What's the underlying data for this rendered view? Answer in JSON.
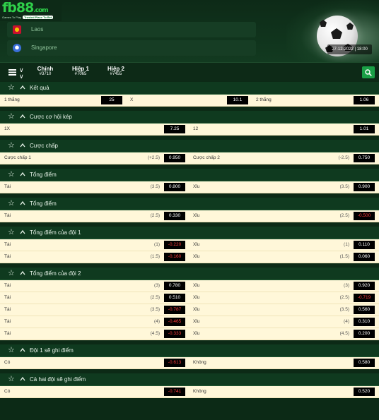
{
  "logo": {
    "brand": "fb88",
    "brand_suffix": ".com",
    "tagline": "Games To Play",
    "tagline_badge": "Trusted Place To Bet"
  },
  "teams": {
    "home": "Laos",
    "away": "Singapore"
  },
  "match_datetime": "27-12-2022 | 18:00",
  "tabs": [
    {
      "label": "Chính",
      "code": "#3710"
    },
    {
      "label": "Hiệp 1",
      "code": "#7065"
    },
    {
      "label": "Hiệp 2",
      "code": "#7455"
    }
  ],
  "colors": {
    "accent": "#1aa046",
    "header_bg": "#0f3a1f",
    "row_bg": "#fff7d9",
    "negative": "#ff3b3b"
  },
  "markets": [
    {
      "title": "Kết quả",
      "layout": "three",
      "rows": [
        {
          "c1_label": "1 thắng",
          "c1_odds": "25",
          "c2_label": "X",
          "c2_odds": "10.1",
          "c3_label": "2 thắng",
          "c3_odds": "1.06"
        }
      ]
    },
    {
      "title": "Cược cơ hội kép",
      "layout": "two",
      "rows": [
        {
          "l_label": "1X",
          "l_hc": "",
          "l_odds": "7.25",
          "r_label": "12",
          "r_hc": "",
          "r_odds": "1.01"
        }
      ]
    },
    {
      "title": "Cược chấp",
      "layout": "two",
      "rows": [
        {
          "l_label": "Cược chấp 1",
          "l_hc": "(+2.5)",
          "l_odds": "0.950",
          "r_label": "Cược chấp 2",
          "r_hc": "(-2.5)",
          "r_odds": "0.750"
        }
      ]
    },
    {
      "title": "Tổng điểm",
      "layout": "two",
      "rows": [
        {
          "l_label": "Tài",
          "l_hc": "(3.5)",
          "l_odds": "0.800",
          "r_label": "Xỉu",
          "r_hc": "(3.5)",
          "r_odds": "0.900"
        }
      ]
    },
    {
      "title": "Tổng điểm",
      "layout": "two",
      "rows": [
        {
          "l_label": "Tài",
          "l_hc": "(2.5)",
          "l_odds": "0.330",
          "r_label": "Xỉu",
          "r_hc": "(2.5)",
          "r_odds": "-0.500"
        }
      ]
    },
    {
      "title": "Tổng điểm của đội 1",
      "layout": "two",
      "rows": [
        {
          "l_label": "Tài",
          "l_hc": "(1)",
          "l_odds": "-0.220",
          "r_label": "Xỉu",
          "r_hc": "(1)",
          "r_odds": "0.110"
        },
        {
          "l_label": "Tài",
          "l_hc": "(1.5)",
          "l_odds": "-0.160",
          "r_label": "Xỉu",
          "r_hc": "(1.5)",
          "r_odds": "0.060"
        }
      ]
    },
    {
      "title": "Tổng điểm của đội 2",
      "layout": "two",
      "rows": [
        {
          "l_label": "Tài",
          "l_hc": "(3)",
          "l_odds": "0.780",
          "r_label": "Xỉu",
          "r_hc": "(3)",
          "r_odds": "0.920"
        },
        {
          "l_label": "Tài",
          "l_hc": "(2.5)",
          "l_odds": "0.510",
          "r_label": "Xỉu",
          "r_hc": "(2.5)",
          "r_odds": "-0.719"
        },
        {
          "l_label": "Tài",
          "l_hc": "(3.5)",
          "l_odds": "-0.787",
          "r_label": "Xỉu",
          "r_hc": "(3.5)",
          "r_odds": "0.560"
        },
        {
          "l_label": "Tài",
          "l_hc": "(4)",
          "l_odds": "-0.465",
          "r_label": "Xỉu",
          "r_hc": "(4)",
          "r_odds": "0.310"
        },
        {
          "l_label": "Tài",
          "l_hc": "(4.5)",
          "l_odds": "-0.333",
          "r_label": "Xỉu",
          "r_hc": "(4.5)",
          "r_odds": "0.200"
        }
      ]
    },
    {
      "title": "Đội 1 sẽ ghi điểm",
      "layout": "two",
      "rows": [
        {
          "l_label": "Có",
          "l_hc": "",
          "l_odds": "-0.613",
          "r_label": "Không",
          "r_hc": "",
          "r_odds": "0.580"
        }
      ]
    },
    {
      "title": "Cả hai đội sẽ ghi điểm",
      "layout": "two",
      "rows": [
        {
          "l_label": "Có",
          "l_hc": "",
          "l_odds": "-0.741",
          "r_label": "Không",
          "r_hc": "",
          "r_odds": "0.520"
        }
      ]
    }
  ]
}
